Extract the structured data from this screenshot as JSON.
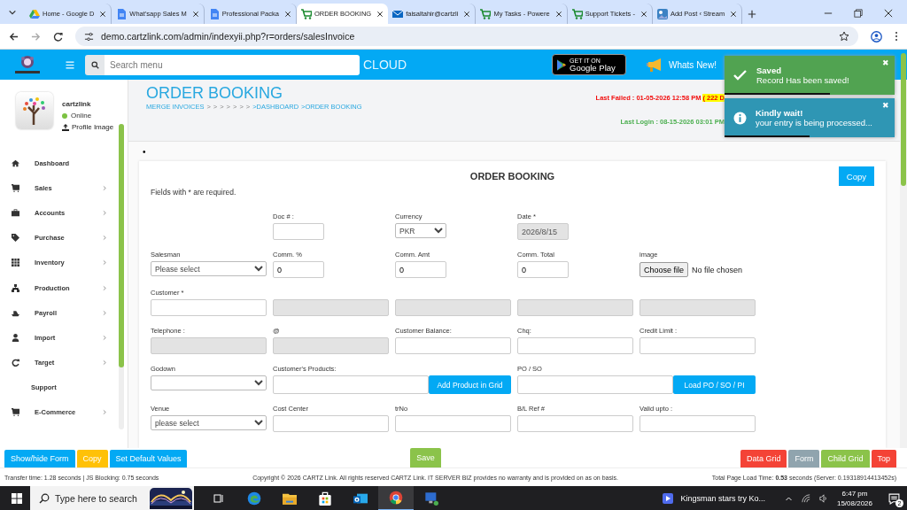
{
  "browser": {
    "tabs": [
      {
        "title": "Home - Google D",
        "selected": false
      },
      {
        "title": "What'sapp Sales M",
        "selected": false
      },
      {
        "title": "Professional Packa",
        "selected": false
      },
      {
        "title": "ORDER BOOKING",
        "selected": true
      },
      {
        "title": "faisaltahir@cartzli",
        "selected": false
      },
      {
        "title": "My Tasks - Powere",
        "selected": false
      },
      {
        "title": "Support Tickets -",
        "selected": false
      },
      {
        "title": "Add Post ‹ Stream",
        "selected": false
      }
    ],
    "url": "demo.cartzlink.com/admin/indexyii.php?r=orders/salesInvoice"
  },
  "header": {
    "search": {
      "placeholder": "Search menu"
    },
    "brand": "CLOUD",
    "play": {
      "small": "GET IT ON",
      "big": "Google Play"
    },
    "whats_new": "Whats New!"
  },
  "toasts": [
    {
      "kind": "success",
      "title": "Saved",
      "message": "Record Has been saved!",
      "close": "✖",
      "level": 0.62
    },
    {
      "kind": "info",
      "title": "Kindly wait!",
      "message": "your entry is being processed...",
      "close": "✖",
      "level": 0.5
    }
  ],
  "sidebar": {
    "user": "cartzlink",
    "status": "Online",
    "profile_link": "Profile Image",
    "items": [
      {
        "label": "Dashboard",
        "expandable": false
      },
      {
        "label": "Sales",
        "expandable": true
      },
      {
        "label": "Accounts",
        "expandable": true
      },
      {
        "label": "Purchase",
        "expandable": true
      },
      {
        "label": "Inventory",
        "expandable": true
      },
      {
        "label": "Production",
        "expandable": true
      },
      {
        "label": "Payroll",
        "expandable": true
      },
      {
        "label": "Import",
        "expandable": true
      },
      {
        "label": "Target",
        "expandable": true
      },
      {
        "label": "Support",
        "expandable": false
      },
      {
        "label": "E-Commerce",
        "expandable": true
      }
    ]
  },
  "page": {
    "title": "ORDER BOOKING",
    "breadcrumbs": [
      "MERGE INVOICES",
      ">",
      ">",
      ">",
      ">",
      ">",
      ">",
      ">",
      ">DASHBOARD",
      ">ORDER BOOKING"
    ],
    "last_failed": "Last Failed : 01-05-2026 12:58 PM",
    "failed_days": "( 222 D",
    "last_login": "Last Login : 08-15-2026 03:01 PM",
    "bullet": "•"
  },
  "form": {
    "title": "ORDER BOOKING",
    "copy": "Copy",
    "note": "Fields with * are required.",
    "rows": [
      [
        "",
        {
          "kind": "input",
          "label": "Doc # :",
          "disabled": false
        },
        {
          "kind": "select",
          "label": "Currency",
          "value": "PKR"
        },
        {
          "kind": "input",
          "label": "Date *",
          "value": "2026/8/15",
          "disabled": true
        }
      ],
      [
        {
          "kind": "select",
          "label": "Salesman",
          "value": "Please select"
        },
        {
          "kind": "input",
          "label": "Comm. %",
          "value": "0",
          "disabled": false
        },
        {
          "kind": "input",
          "label": "Comm. Amt",
          "value": "0",
          "disabled": false
        },
        {
          "kind": "input",
          "label": "Comm. Total",
          "value": "0",
          "disabled": false
        },
        {
          "kind": "file",
          "label": "image",
          "button": "Choose file",
          "value": "No file chosen"
        }
      ],
      [
        {
          "kind": "input",
          "label": "Customer *",
          "disabled": false
        },
        {
          "kind": "input",
          "disabled": true
        },
        {
          "kind": "input",
          "disabled": true
        },
        {
          "kind": "input",
          "disabled": true
        },
        {
          "kind": "input",
          "disabled": true
        }
      ],
      [
        {
          "kind": "input",
          "label": "Telephone :",
          "disabled": true
        },
        {
          "kind": "input",
          "label": "@",
          "disabled": true
        },
        {
          "kind": "input",
          "label": "Customer Balance:",
          "disabled": false
        },
        {
          "kind": "input",
          "label": "Chq:",
          "disabled": false
        },
        {
          "kind": "input",
          "label": "Credit Limit :",
          "disabled": false
        }
      ],
      [
        {
          "kind": "select",
          "label": "Godown"
        },
        {
          "kind": "input_button",
          "label": "Customer's Products:",
          "button": "Add Product in Grid"
        },
        "",
        {
          "kind": "input_button",
          "label": "PO / SO",
          "button": "Load PO / SO / PI"
        },
        ""
      ],
      [
        {
          "kind": "select",
          "label": "Venue",
          "value": "please select"
        },
        {
          "kind": "input",
          "label": "Cost Center",
          "disabled": false
        },
        {
          "kind": "input",
          "label": "trNo",
          "disabled": false
        },
        {
          "kind": "input",
          "label": "B/L Ref #",
          "disabled": false
        },
        {
          "kind": "input",
          "label": "Valid upto :",
          "disabled": false
        }
      ]
    ]
  },
  "actions": {
    "left": [
      {
        "label": "Show/hide Form",
        "color": "#03a9f4"
      },
      {
        "label": "Copy",
        "color": "#ffc107"
      },
      {
        "label": "Set Default Values",
        "color": "#03a9f4"
      }
    ],
    "center": [
      {
        "label": "Save",
        "color": "#8bc34a"
      }
    ],
    "right": [
      {
        "label": "Data Grid",
        "color": "#f44336"
      },
      {
        "label": "Form",
        "color": "#90a4ae"
      },
      {
        "label": "Child Grid",
        "color": "#8bc34a"
      },
      {
        "label": "Top",
        "color": "#f44336"
      }
    ]
  },
  "footer": {
    "transfer": "Transfer time: 1.28 seconds | JS Blocking: 0.75 seconds",
    "copyright": "Copyright © 2026 CARTZ Link. All rights reserved CARTZ Link. IT SERVER BIZ provides no warranty and is provided on as on basis.",
    "load_time": "Total Page Load Time: **0.53** seconds (Server: 0.19318914413452s)"
  },
  "taskbar": {
    "search": {
      "placeholder": "Type here to search"
    },
    "news": "Kingsman stars try Ko...",
    "time": "6:47 pm",
    "date": "15/08/2026",
    "notifications": "2"
  }
}
